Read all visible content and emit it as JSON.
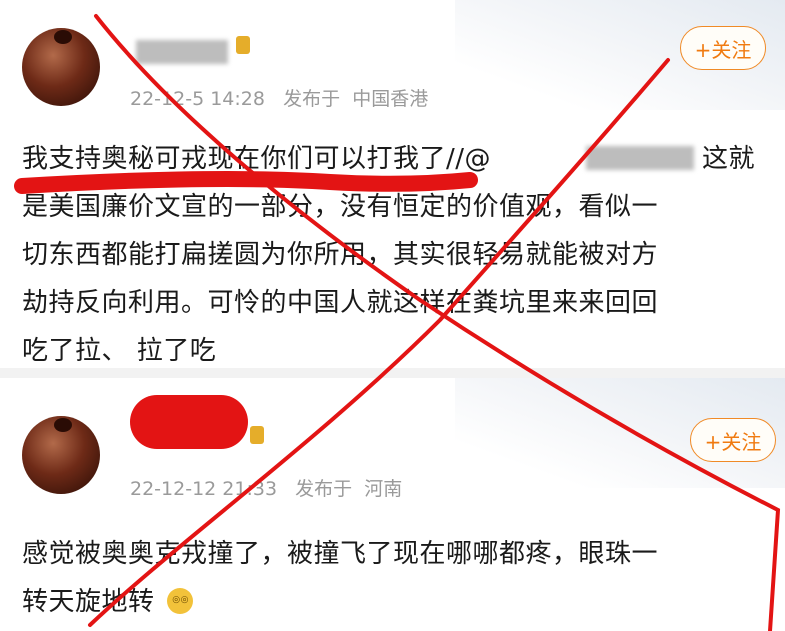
{
  "post1": {
    "timestamp": "22-12-5 14:28",
    "location_prefix": "发布于",
    "location": "中国香港",
    "follow_label": "+关注",
    "lines": [
      "我支持奥秘可戎现在你们可以打我了//@",
      "这就",
      "是美国廉价文宣的一部分，没有恒定的价值观，看似一",
      "切东西都能打扁搓圆为你所用，其实很轻易就能被对方",
      "劫持反向利用。可怜的中国人就这样在粪坑里来来回回",
      "吃了拉、 拉了吃"
    ]
  },
  "post2": {
    "timestamp": "22-12-12 21:33",
    "location_prefix": "发布于",
    "location": "河南",
    "follow_label": "+关注",
    "lines": [
      "感觉被奥奥克戎撞了，被撞飞了现在哪哪都疼，眼珠一",
      "转天旋地转"
    ],
    "emoji": "dizzy-face-icon"
  },
  "colors": {
    "accent": "#f07a10",
    "redmark": "#e31414",
    "meta": "#9a9a9a",
    "text": "#1a1a1a"
  }
}
